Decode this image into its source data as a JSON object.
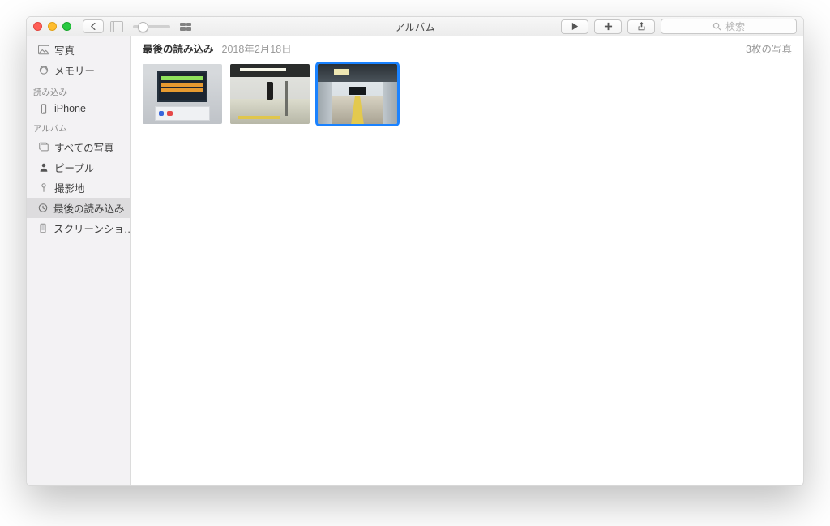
{
  "window": {
    "title": "アルバム"
  },
  "toolbar": {
    "search_placeholder": "検索"
  },
  "sidebar": {
    "top": [
      {
        "label": "写真",
        "icon": "photos"
      },
      {
        "label": "メモリー",
        "icon": "memory"
      }
    ],
    "import_header": "読み込み",
    "import": [
      {
        "label": "iPhone",
        "icon": "iphone"
      }
    ],
    "album_header": "アルバム",
    "albums": [
      {
        "label": "すべての写真",
        "icon": "stack"
      },
      {
        "label": "ピープル",
        "icon": "person"
      },
      {
        "label": "撮影地",
        "icon": "pin"
      },
      {
        "label": "最後の読み込み",
        "icon": "clock",
        "selected": true
      },
      {
        "label": "スクリーンショ…",
        "icon": "device"
      }
    ]
  },
  "content": {
    "heading": "最後の読み込み",
    "date": "2018年2月18日",
    "count": "3枚の写真",
    "thumbs": [
      {
        "selected": false
      },
      {
        "selected": false
      },
      {
        "selected": true
      }
    ]
  }
}
